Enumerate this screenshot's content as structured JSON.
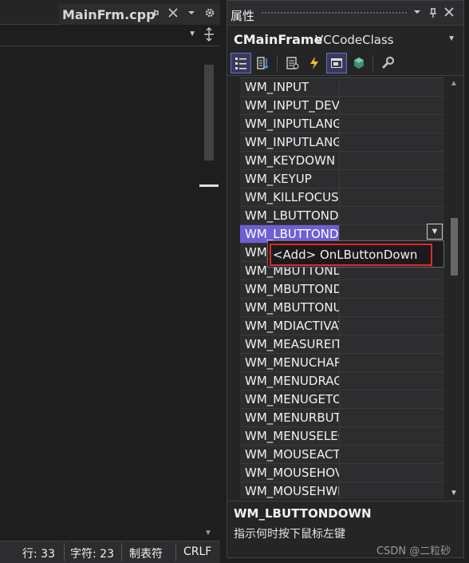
{
  "editor": {
    "tab_title": "MainFrm.cpp",
    "tab_pin_icon": "pin-icon",
    "tab_close_icon": "close-icon",
    "status": {
      "line": "行: 33",
      "char": "字符: 23",
      "tabs": "制表符",
      "eol": "CRLF"
    }
  },
  "properties": {
    "title": "属性",
    "object_name": "CMainFrame",
    "object_type": "VCCodeClass",
    "toolbar": {
      "categorized": "categorized-icon",
      "alphabetical": "alphabetical-icon",
      "property_pages": "property-pages-icon",
      "events": "events-icon",
      "messages": "messages-icon",
      "virtual_functions": "virtual-functions-icon",
      "overrides": "overrides-icon"
    },
    "messages": [
      "WM_INPUT",
      "WM_INPUT_DEVICE_CHANGE",
      "WM_INPUTLANGCHANGE",
      "WM_INPUTLANGCHANGEREQUEST",
      "WM_KEYDOWN",
      "WM_KEYUP",
      "WM_KILLFOCUS",
      "WM_LBUTTONDBLCLK",
      "WM_LBUTTONDOWN",
      "WM_LBUTTONUP",
      "WM_MBUTTONDBLCLK",
      "WM_MBUTTONDOWN",
      "WM_MBUTTONUP",
      "WM_MDIACTIVATE",
      "WM_MEASUREITEM",
      "WM_MENUCHAR",
      "WM_MENUDRAG",
      "WM_MENUGETOBJECT",
      "WM_MENURBUTTONUP",
      "WM_MENUSELECT",
      "WM_MOUSEACTIVATE",
      "WM_MOUSEHOVER",
      "WM_MOUSEHWHEEL"
    ],
    "selected_message": "WM_LBUTTONDOWN",
    "dropdown_item": "<Add> OnLButtonDown",
    "description_title": "WM_LBUTTONDOWN",
    "description_text": "指示何时按下鼠标左键"
  },
  "watermark": "CSDN @二粒砂",
  "colors": {
    "selection": "#6f5fd6",
    "highlight_box": "#e02a2a"
  }
}
